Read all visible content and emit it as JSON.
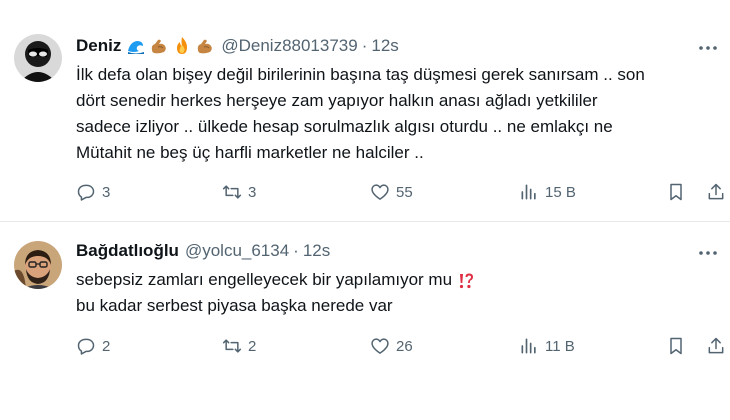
{
  "tweets": [
    {
      "author_name": "Deniz",
      "emojis": [
        "wave-emoji",
        "flexed-biceps-emoji",
        "fire-emoji",
        "flexed-biceps-emoji"
      ],
      "handle": "@Deniz88013739",
      "separator": "·",
      "time": "12s",
      "body_lines": [
        "İlk defa olan bişey değil birilerinin başına taş düşmesi gerek sanırsam .. son",
        "dört senedir herkes herşeye zam yapıyor halkın anası ağladı yetkililer",
        "sadece izliyor .. ülkede hesap sorulmazlık algısı oturdu .. ne emlakçı ne",
        "Mütahit ne beş üç harfli marketler ne halciler .."
      ],
      "replies": "3",
      "reposts": "3",
      "likes": "55",
      "views": "15 B"
    },
    {
      "author_name": "Bağdatlıoğlu",
      "handle": "@yolcu_6134",
      "separator": "·",
      "time": "12s",
      "body_lines": [
        "sebepsiz zamları engelleyecek bir yapılamıyor mu",
        "bu kadar serbest piyasa başka nerede var"
      ],
      "trailing_emoji": "interrobang-emoji",
      "replies": "2",
      "reposts": "2",
      "likes": "26",
      "views": "11 B"
    }
  ],
  "colors": {
    "text": "#0f1419",
    "secondary": "#536471",
    "divider": "#e6e9ec",
    "wave": "#1d9bf0",
    "fire": "#f4900c",
    "biceps": "#c68642",
    "interrobang": "#dd2e44"
  },
  "icons": [
    "reply-icon",
    "repost-icon",
    "like-icon",
    "views-icon",
    "bookmark-icon",
    "share-icon",
    "more-icon"
  ]
}
